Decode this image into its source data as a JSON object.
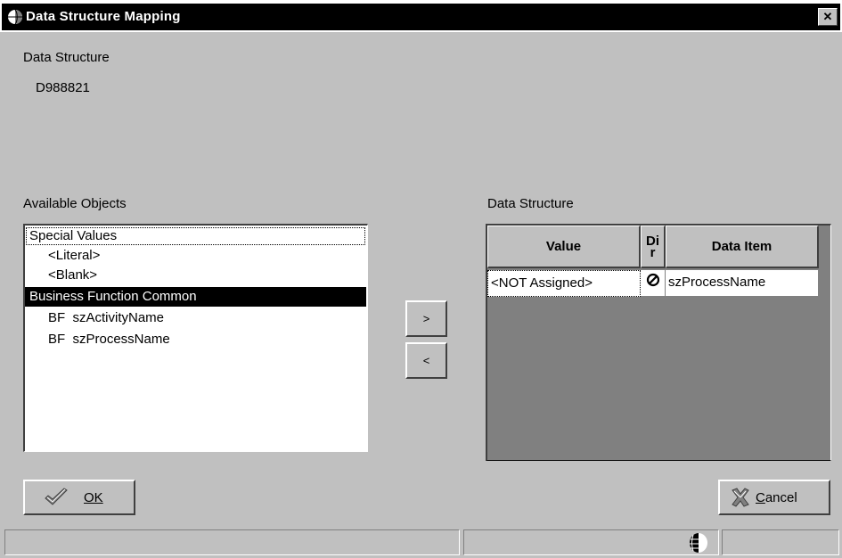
{
  "window": {
    "title": "Data Structure Mapping",
    "close_label": "✕"
  },
  "header": {
    "data_structure_label": "Data Structure",
    "data_structure_value": "D988821"
  },
  "available_objects": {
    "label": "Available Objects",
    "items": [
      {
        "label": "Special Values"
      },
      {
        "label": "<Literal>"
      },
      {
        "label": "<Blank>"
      },
      {
        "label": "Business Function Common"
      },
      {
        "label": "BF  szActivityName"
      },
      {
        "label": "BF  szProcessName"
      }
    ]
  },
  "move_buttons": {
    "add_label": ">",
    "remove_label": "<"
  },
  "data_structure_grid": {
    "label": "Data Structure",
    "columns": [
      "Value",
      "Di\nr",
      "Data Item"
    ],
    "rows": [
      {
        "value": "<NOT Assigned>",
        "dir": "not-allowed-icon",
        "data_item": "szProcessName"
      }
    ]
  },
  "buttons": {
    "ok_label": "OK",
    "cancel_label": "Cancel"
  },
  "colors": {
    "window_bg": "#c0c0c0",
    "title_bg": "#000000",
    "selection_bg": "#000000",
    "grid_bg": "#808080"
  }
}
